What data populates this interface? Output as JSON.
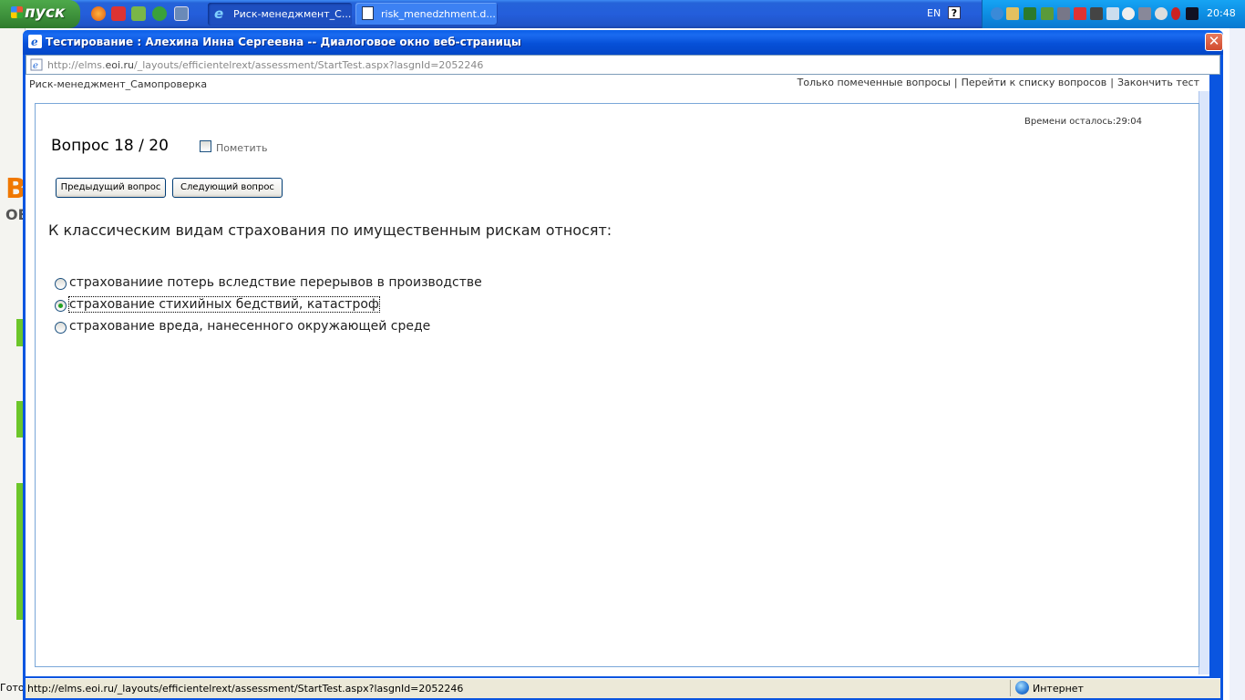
{
  "taskbar": {
    "start_label": "пуск",
    "tasks": [
      {
        "label": "Риск-менеджмент_С..."
      },
      {
        "label": "risk_menedzhment.d..."
      }
    ],
    "lang": "EN",
    "help": "?",
    "clock": "20:48"
  },
  "dialog": {
    "title": "Тестирование : Алехина Инна Сергеевна -- Диалоговое окно веб-страницы",
    "close": "✕",
    "address_prefix": "http://elms.",
    "address_domain": "eoi.ru",
    "address_rest": "/_layouts/efficientelrext/assessment/StartTest.aspx?lasgnId=2052246"
  },
  "header": {
    "course": "Риск-менеджмент_Самопроверка",
    "links": [
      {
        "label": "Только помеченные вопросы"
      },
      {
        "label": "Перейти к списку вопросов"
      },
      {
        "label": "Закончить тест"
      }
    ],
    "separator": "|"
  },
  "test": {
    "timer": "Времени осталось:29:04",
    "question_number": "Вопрос 18 / 20",
    "mark_label": "Пометить",
    "prev_button": "Предыдущий вопрос",
    "next_button": "Следующий вопрос",
    "question": "К классическим видам страхования по имущественным рискам относят:",
    "options": [
      {
        "label": "страхованиие потерь вследствие перерывов в производстве",
        "selected": false
      },
      {
        "label": "страхование стихийных бедствий, катастроф",
        "selected": true
      },
      {
        "label": "страхование вреда, нанесенного окружающей среде",
        "selected": false
      }
    ]
  },
  "statusbar": {
    "url": "http://elms.eoi.ru/_layouts/efficientelrext/assessment/StartTest.aspx?lasgnId=2052246",
    "zone": "Интернет"
  },
  "background": {
    "status": "Гото"
  },
  "colors": {
    "taskbar": "#245edb",
    "dialog_title": "#0650d8",
    "selected_radio": "#21a121"
  }
}
